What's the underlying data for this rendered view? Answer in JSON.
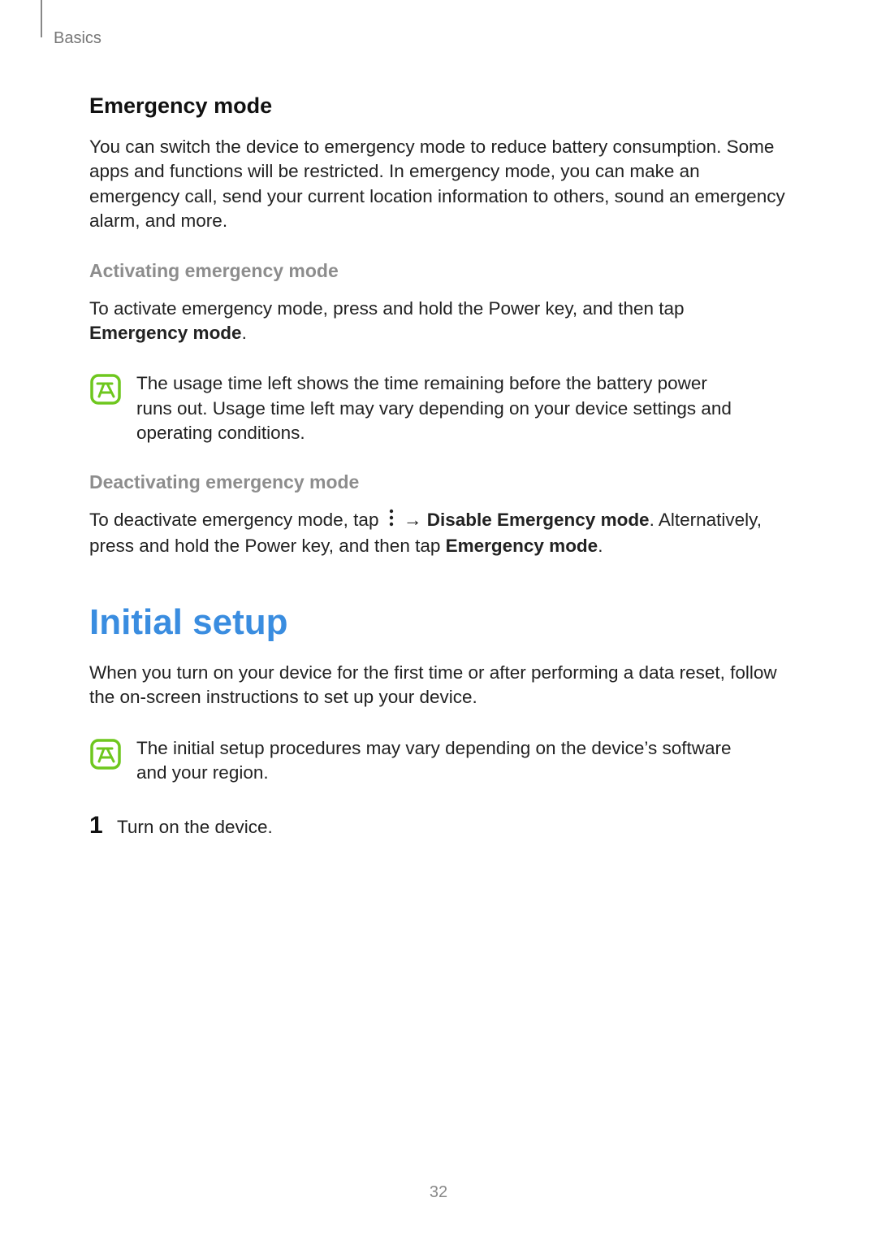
{
  "header": {
    "chapter": "Basics"
  },
  "emergency": {
    "title": "Emergency mode",
    "intro": "You can switch the device to emergency mode to reduce battery consumption. Some apps and functions will be restricted. In emergency mode, you can make an emergency call, send your current location information to others, sound an emergency alarm, and more.",
    "activate": {
      "heading": "Activating emergency mode",
      "text_before": "To activate emergency mode, press and hold the Power key, and then tap ",
      "bold": "Emergency mode",
      "text_after": "."
    },
    "note": "The usage time left shows the time remaining before the battery power runs out. Usage time left may vary depending on your device settings and operating conditions.",
    "deactivate": {
      "heading": "Deactivating emergency mode",
      "part1": "To deactivate emergency mode, tap ",
      "arrow": " → ",
      "bold1": "Disable Emergency mode",
      "part2": ". Alternatively, press and hold the Power key, and then tap ",
      "bold2": "Emergency mode",
      "part3": "."
    }
  },
  "initial": {
    "title": "Initial setup",
    "intro": "When you turn on your device for the first time or after performing a data reset, follow the on-screen instructions to set up your device.",
    "note": "The initial setup procedures may vary depending on the device’s software and your region.",
    "step1_num": "1",
    "step1_text": "Turn on the device."
  },
  "page_number": "32"
}
